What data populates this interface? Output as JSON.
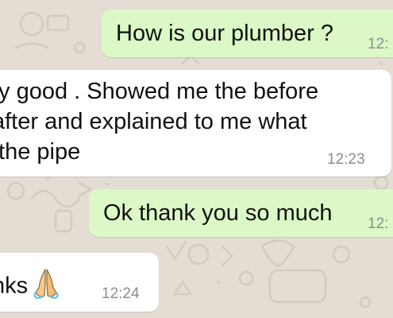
{
  "chat": {
    "messages": [
      {
        "direction": "outgoing",
        "text": "How is our plumber ?",
        "time": "12:"
      },
      {
        "direction": "incoming",
        "text": "ty good . Showed me the before\nafter and explained to me what\n the pipe",
        "time": "12:23"
      },
      {
        "direction": "outgoing",
        "text": "Ok thank you so much",
        "time": "12:"
      },
      {
        "direction": "incoming",
        "text": "nks",
        "time": "12:24",
        "emoji": "folded-hands-icon"
      }
    ]
  },
  "colors": {
    "background": "#e4ddd4",
    "outgoing_bubble": "#dcf8c6",
    "incoming_bubble": "#ffffff",
    "timestamp": "#8a8f8c"
  }
}
